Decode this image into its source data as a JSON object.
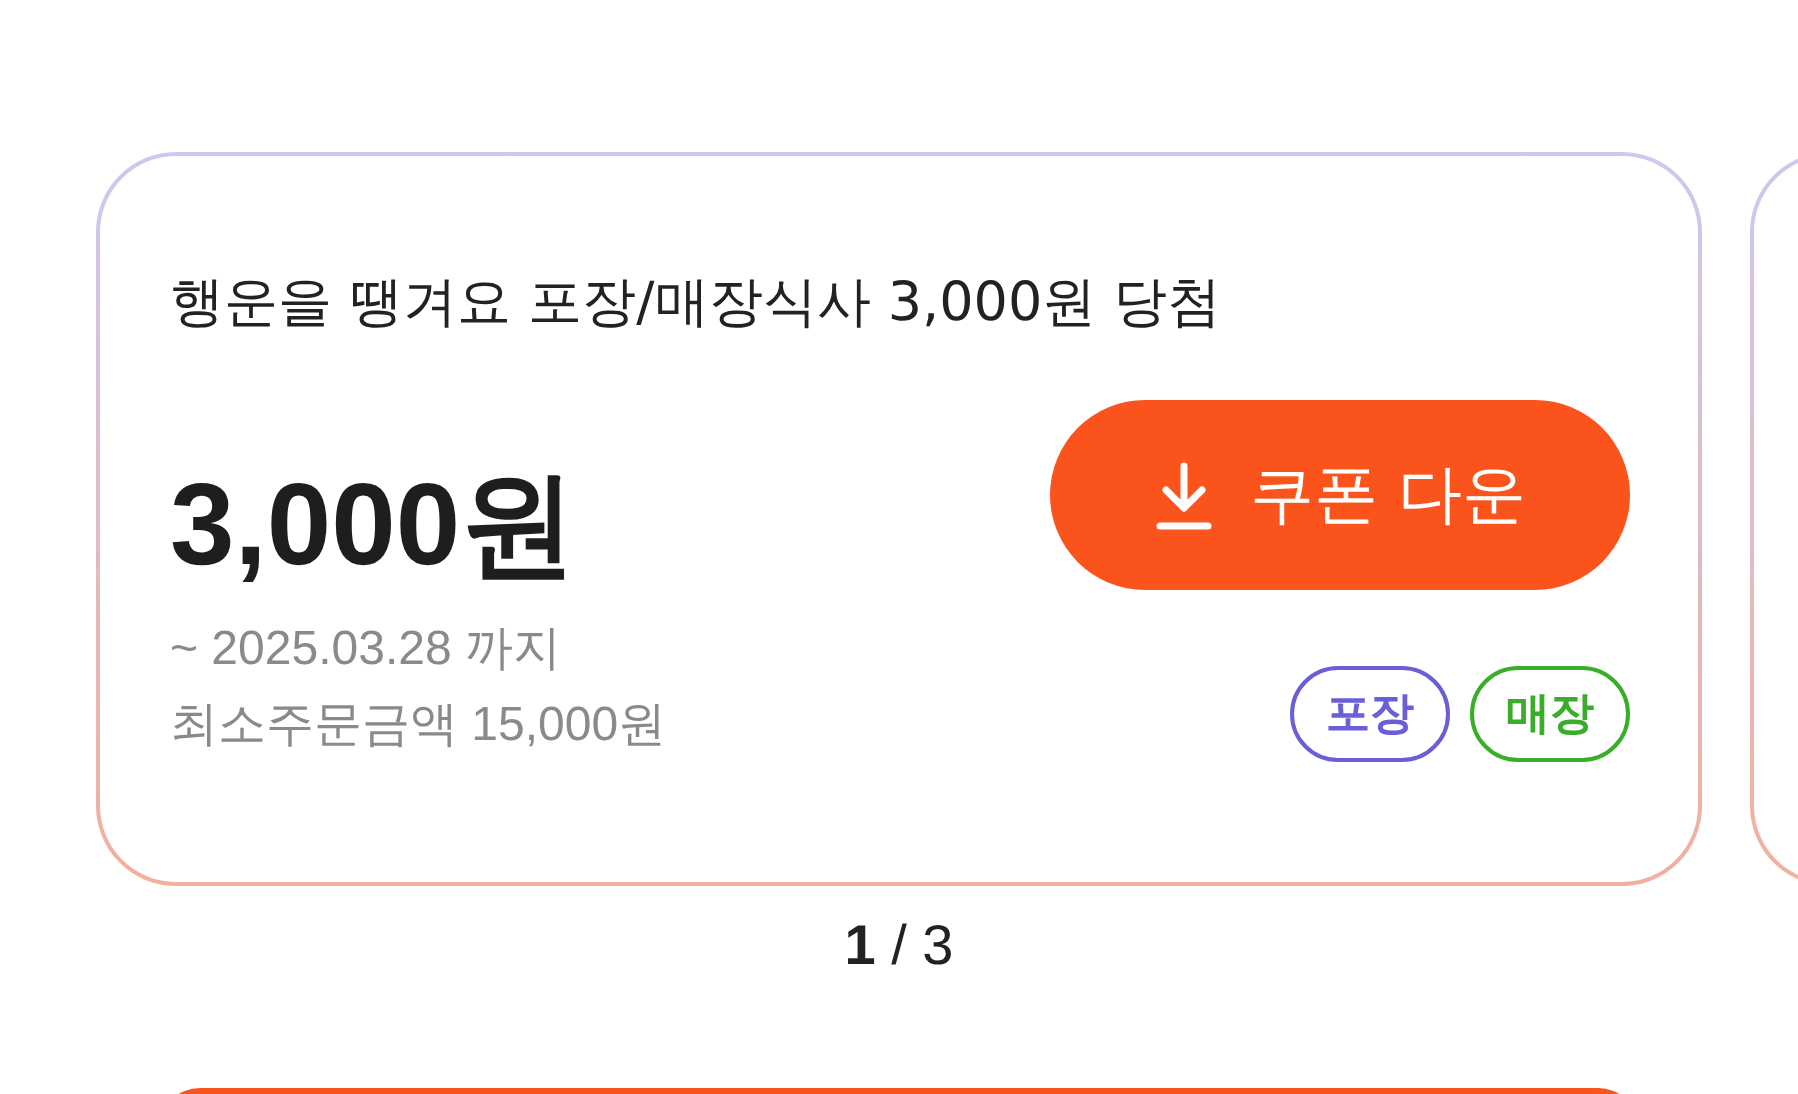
{
  "coupon": {
    "title": "행운을 땡겨요 포장/매장식사 3,000원 당첨",
    "amount": "3,000원",
    "expiry": "~ 2025.03.28 까지",
    "min_order": "최소주문금액 15,000원",
    "button": "쿠폰 다운",
    "tags": [
      {
        "label": "포장",
        "color": "#6a5fd6"
      },
      {
        "label": "매장",
        "color": "#3aae2a"
      }
    ]
  },
  "pager": {
    "text": "**1** / 3"
  }
}
